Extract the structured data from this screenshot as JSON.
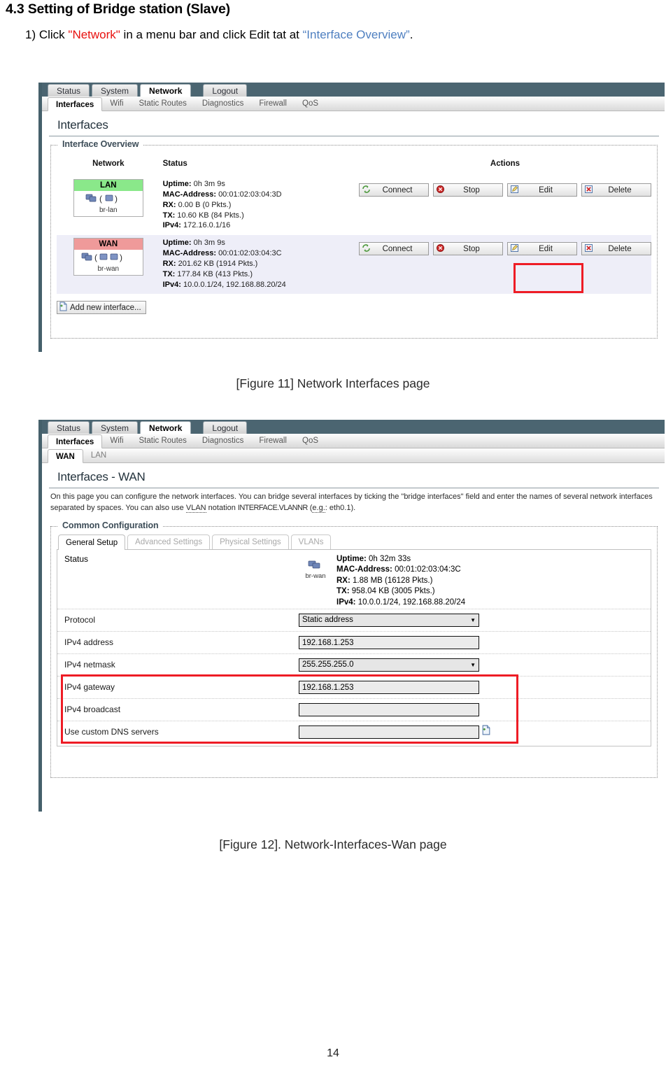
{
  "document": {
    "heading": "4.3 Setting of Bridge station (Slave)",
    "step": {
      "prefix": "1) Click ",
      "quoted_red": "\"Network\"",
      "middle": " in a menu bar and click Edit tat at ",
      "quoted_blue": "“Interface Overview”",
      "suffix": "."
    },
    "figure11_caption": "[Figure 11] Network Interfaces page",
    "figure12_caption": "[Figure 12]. Network-Interfaces-Wan page",
    "page_number": "14",
    "colors": {
      "red_highlight": "#ee1c25",
      "red_text": "#e8110f",
      "blue_text": "#4e7fc0",
      "lan_badge": "#8ae88a",
      "wan_badge": "#ef9a9a",
      "chrome_bar": "#4b6571"
    }
  },
  "figure11": {
    "menu_tabs": [
      {
        "label": "Status",
        "active": false
      },
      {
        "label": "System",
        "active": false
      },
      {
        "label": "Network",
        "active": true
      },
      {
        "label": "Logout",
        "active": false
      }
    ],
    "sub_tabs": [
      {
        "label": "Interfaces",
        "active": true
      },
      {
        "label": "Wifi",
        "active": false
      },
      {
        "label": "Static Routes",
        "active": false
      },
      {
        "label": "Diagnostics",
        "active": false
      },
      {
        "label": "Firewall",
        "active": false
      },
      {
        "label": "QoS",
        "active": false
      }
    ],
    "page_title": "Interfaces",
    "fieldset_legend": "Interface Overview",
    "table_headers": {
      "network": "Network",
      "status": "Status",
      "actions": "Actions"
    },
    "rows": [
      {
        "badge": "LAN",
        "badge_color": "lan",
        "device": "br-lan",
        "icons": "network-bridge-icon",
        "status": {
          "uptime_label": "Uptime:",
          "uptime_value": "0h 3m 9s",
          "mac_label": "MAC-Address:",
          "mac_value": "00:01:02:03:04:3D",
          "rx_label": "RX:",
          "rx_value": "0.00 B (0 Pkts.)",
          "tx_label": "TX:",
          "tx_value": "10.60 KB (84 Pkts.)",
          "ipv4_label": "IPv4:",
          "ipv4_value": "172.16.0.1/16"
        },
        "actions": [
          "Connect",
          "Stop",
          "Edit",
          "Delete"
        ],
        "highlight_edit": false
      },
      {
        "badge": "WAN",
        "badge_color": "wan",
        "device": "br-wan",
        "icons": "network-bridge-icon",
        "status": {
          "uptime_label": "Uptime:",
          "uptime_value": "0h 3m 9s",
          "mac_label": "MAC-Address:",
          "mac_value": "00:01:02:03:04:3C",
          "rx_label": "RX:",
          "rx_value": "201.62 KB (1914 Pkts.)",
          "tx_label": "TX:",
          "tx_value": "177.84 KB (413 Pkts.)",
          "ipv4_label": "IPv4:",
          "ipv4_value": "10.0.0.1/24, 192.168.88.20/24"
        },
        "actions": [
          "Connect",
          "Stop",
          "Edit",
          "Delete"
        ],
        "highlight_edit": true
      }
    ],
    "add_button": "Add new interface..."
  },
  "figure12": {
    "menu_tabs": [
      {
        "label": "Status",
        "active": false
      },
      {
        "label": "System",
        "active": false
      },
      {
        "label": "Network",
        "active": true
      },
      {
        "label": "Logout",
        "active": false
      }
    ],
    "sub_tabs": [
      {
        "label": "Interfaces",
        "active": true
      },
      {
        "label": "Wifi",
        "active": false
      },
      {
        "label": "Static Routes",
        "active": false
      },
      {
        "label": "Diagnostics",
        "active": false
      },
      {
        "label": "Firewall",
        "active": false
      },
      {
        "label": "QoS",
        "active": false
      }
    ],
    "iface_tabs": [
      {
        "label": "WAN",
        "active": true
      },
      {
        "label": "LAN",
        "active": false
      }
    ],
    "page_title": "Interfaces - WAN",
    "description": "On this page you can configure the network interfaces. You can bridge several interfaces by ticking the \"bridge interfaces\" field and enter the names of several network interfaces separated by spaces. You can also use VLAN notation INTERFACE.VLANNR (e.g.: eth0.1).",
    "description_parts": {
      "p1": "On this page you can configure the network interfaces. You can bridge several interfaces by ticking the \"bridge interfaces\" field and enter the names of several network interfaces separated by spaces. You can also use ",
      "vlan": "VLAN",
      "p2": " notation ",
      "mono": "INTERFACE.VLANNR",
      "p3": " (",
      "eg": "e.g.",
      "p4": ": eth0.1)."
    },
    "fieldset_legend": "Common Configuration",
    "config_tabs": [
      {
        "label": "General Setup",
        "active": true
      },
      {
        "label": "Advanced Settings",
        "active": false
      },
      {
        "label": "Physical Settings",
        "active": false
      },
      {
        "label": "VLANs",
        "active": false
      }
    ],
    "status_row": {
      "label": "Status",
      "device": "br-wan",
      "uptime_label": "Uptime:",
      "uptime_value": "0h 32m 33s",
      "mac_label": "MAC-Address:",
      "mac_value": "00:01:02:03:04:3C",
      "rx_label": "RX:",
      "rx_value": "1.88 MB (16128 Pkts.)",
      "tx_label": "TX:",
      "tx_value": "958.04 KB (3005 Pkts.)",
      "ipv4_label": "IPv4:",
      "ipv4_value": "10.0.0.1/24, 192.168.88.20/24"
    },
    "fields": [
      {
        "label": "Protocol",
        "type": "select",
        "value": "Static address",
        "highlight": false
      },
      {
        "label": "IPv4 address",
        "type": "text",
        "value": "192.168.1.253",
        "highlight": true
      },
      {
        "label": "IPv4 netmask",
        "type": "select",
        "value": "255.255.255.0",
        "highlight": true
      },
      {
        "label": "IPv4 gateway",
        "type": "text",
        "value": "192.168.1.253",
        "highlight": true
      },
      {
        "label": "IPv4 broadcast",
        "type": "text",
        "value": "",
        "highlight": false
      },
      {
        "label": "Use custom DNS servers",
        "type": "text+add",
        "value": "",
        "highlight": false
      }
    ]
  }
}
